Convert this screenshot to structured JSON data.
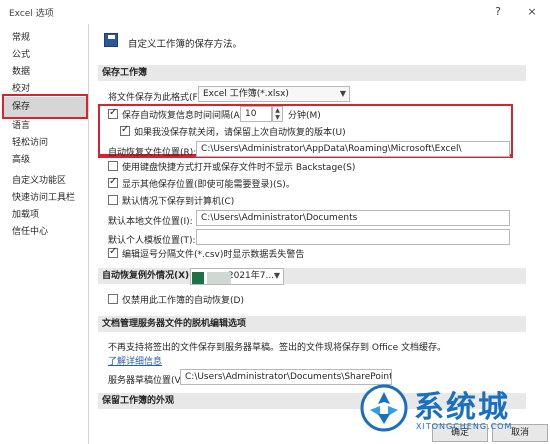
{
  "window": {
    "title": "Excel 选项",
    "help": "?",
    "close": "×"
  },
  "nav": {
    "items": [
      "常规",
      "公式",
      "数据",
      "校对",
      "保存",
      "语言",
      "轻松访问",
      "高级",
      "自定义功能区",
      "快速访问工具栏",
      "加载项",
      "信任中心"
    ],
    "selected": "保存"
  },
  "header": {
    "text": "自定义工作簿的保存方法。"
  },
  "save_workbooks": {
    "section_title": "保存工作簿",
    "format_label": "将文件保存为此格式(F):",
    "format_value": "Excel 工作簿(*.xlsx)",
    "autorecover_label": "保存自动恢复信息时间间隔(A)",
    "autorecover_checked": true,
    "autorecover_minutes": "10",
    "minutes_unit": "分钟(M)",
    "keep_last_label": "如果我没保存就关闭，请保留上次自动恢复的版本(U)",
    "keep_last_checked": true,
    "autorecover_location_label": "自动恢复文件位置(R):",
    "autorecover_location_value": "C:\\Users\\Administrator\\AppData\\Roaming\\Microsoft\\Excel\\",
    "no_backstage_label": "使用键盘快捷方式打开或保存文件时不显示 Backstage(S)",
    "no_backstage_checked": false,
    "show_additional_label": "显示其他保存位置(即使可能需要登录)(S)。",
    "show_additional_checked": true,
    "save_to_computer_label": "默认情况下保存到计算机(C)",
    "save_to_computer_checked": false,
    "default_local_label": "默认本地文件位置(I):",
    "default_local_value": "C:\\Users\\Administrator\\Documents",
    "default_template_label": "默认个人模板位置(T):",
    "default_template_value": "",
    "csv_warning_label": "编辑逗号分隔文件(*.csv)时显示数据丢失警告",
    "csv_warning_checked": true
  },
  "autorecover_exceptions": {
    "label": "自动恢复例外情况(X):",
    "workbook_value": "2021年7...",
    "disable_label": "仅禁用此工作簿的自动恢复(D)",
    "disable_checked": false
  },
  "offline_editing": {
    "section_title": "文档管理服务器文件的脱机编辑选项",
    "description": "不再支持将签出的文件保存到服务器草稿。签出的文件现将保存到 Office 文档缓存。",
    "learn_more": "了解详细信息",
    "drafts_label": "服务器草稿位置(V):",
    "drafts_value": "C:\\Users\\Administrator\\Documents\\SharePoint 草稿\\"
  },
  "preserve": {
    "section_title": "保留工作簿的外观"
  },
  "buttons": {
    "ok": "确定",
    "cancel": "取消"
  },
  "watermark": {
    "text": "系统城",
    "sub": "XITONGCHENG.COM"
  },
  "colors": {
    "highlight_red": "#d1252f",
    "section_bg": "#e8e8e8",
    "selected_nav": "#d6d6d6",
    "link_blue": "#2a5caa",
    "excel_green": "#1e7145",
    "watermark_blue": "#1a6fc0"
  }
}
